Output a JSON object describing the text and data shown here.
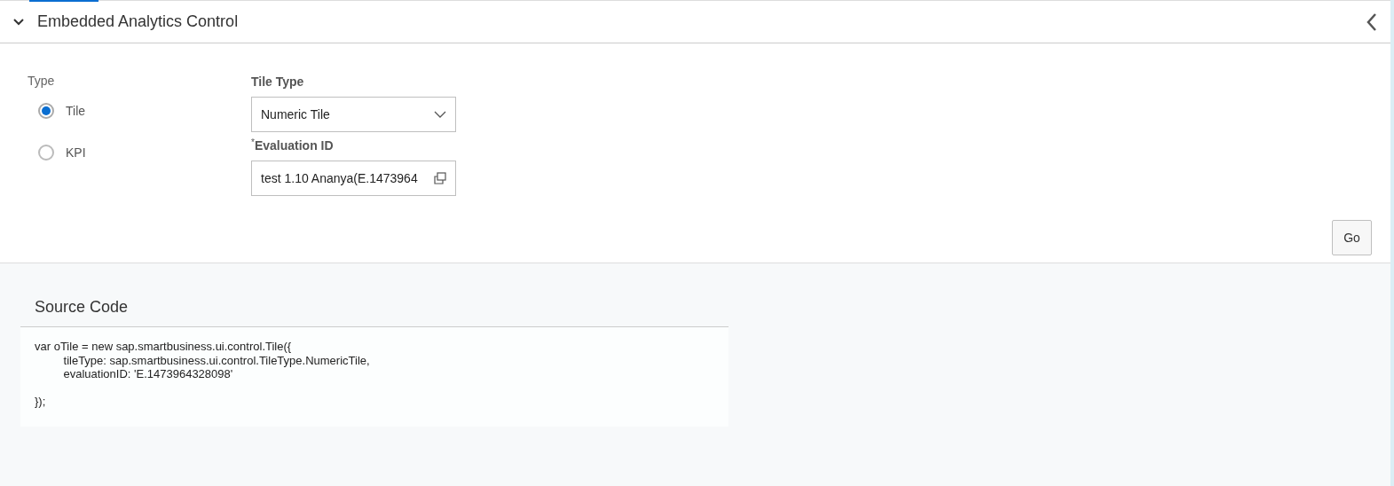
{
  "panel": {
    "title": "Embedded Analytics Control",
    "expanded": true
  },
  "type_group": {
    "label": "Type",
    "options": [
      {
        "label": "Tile",
        "selected": true
      },
      {
        "label": "KPI",
        "selected": false
      }
    ]
  },
  "tile_type": {
    "label": "Tile Type",
    "value": "Numeric Tile"
  },
  "evaluation_id": {
    "label": "Evaluation ID",
    "required_mark": "*",
    "value": "test 1.10 Ananya(E.1473964"
  },
  "go_button": "Go",
  "source_code": {
    "title": "Source Code",
    "code": "var oTile = new sap.smartbusiness.ui.control.Tile({\n\ttileType: sap.smartbusiness.ui.control.TileType.NumericTile,\n\tevaluationID: 'E.1473964328098'\n\n});"
  }
}
